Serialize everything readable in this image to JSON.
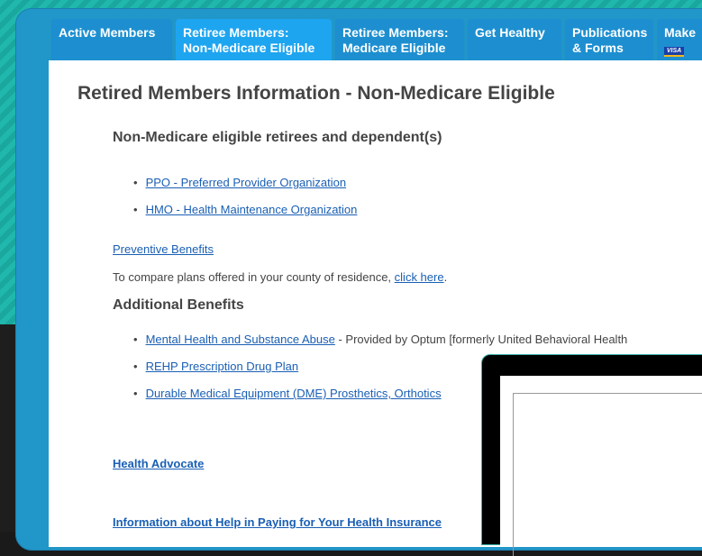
{
  "tabs": [
    {
      "line1": "Active Members",
      "line2": ""
    },
    {
      "line1": "Retiree Members:",
      "line2": "Non-Medicare Eligible"
    },
    {
      "line1": "Retiree Members:",
      "line2": "Medicare Eligible"
    },
    {
      "line1": "Get Healthy",
      "line2": ""
    },
    {
      "line1": "Publications",
      "line2": "& Forms"
    },
    {
      "line1": "Make",
      "line2": ""
    }
  ],
  "page_title": "Retired Members Information - Non-Medicare Eligible",
  "section1_heading": "Non-Medicare eligible retirees and dependent(s)",
  "plans": [
    {
      "link": "PPO - Preferred Provider Organization"
    },
    {
      "link": "HMO - Health Maintenance Organization"
    }
  ],
  "preventive_link": "Preventive Benefits",
  "compare": {
    "text": "To compare plans offered in your county of residence, ",
    "link": "click here",
    "end": "."
  },
  "section2_heading": "Additional Benefits",
  "additional": [
    {
      "link": "Mental Health and Substance Abuse",
      "text": " - Provided by Optum [formerly United Behavioral Health"
    },
    {
      "link": "REHP Prescription Drug Plan",
      "text": ""
    },
    {
      "link": "Durable Medical Equipment (DME) Prosthetics, Orthotics",
      "text": ""
    }
  ],
  "health_advocate_link": "Health Advocate",
  "help_paying_link": "Information about Help in Paying for Your Health Insurance",
  "visa_badge": "VISA"
}
